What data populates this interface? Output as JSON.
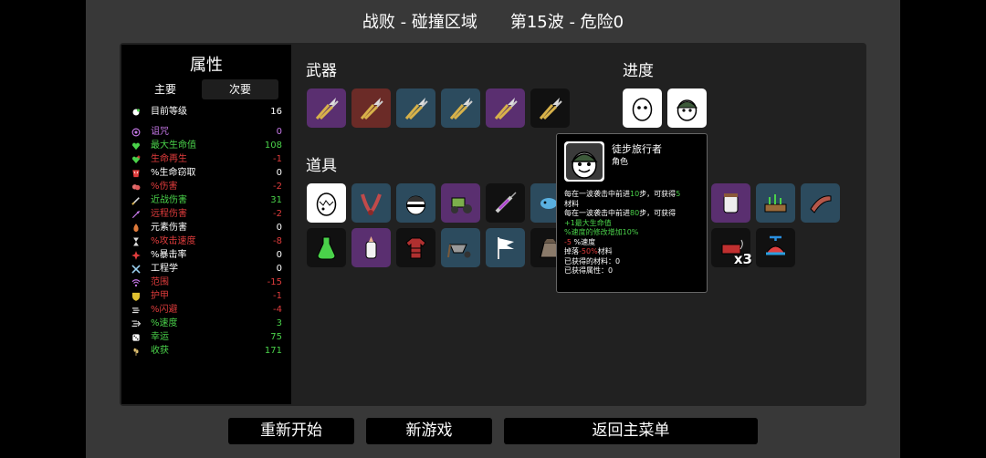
{
  "header": {
    "title": "战败 - 碰撞区域　　第15波 - 危险0"
  },
  "stats": {
    "title": "属性",
    "tab_main": "主要",
    "tab_secondary": "次要",
    "level": {
      "label": "目前等级",
      "value": "16",
      "color": "#ffffff",
      "icon": "level-icon"
    },
    "rows": [
      {
        "label": "诅咒",
        "value": "0",
        "color": "#c678e8",
        "icon": "curse-icon"
      },
      {
        "label": "最大生命值",
        "value": "108",
        "color": "#4ad24a",
        "icon": "heart-icon"
      },
      {
        "label": "生命再生",
        "value": "-1",
        "color": "#e03c3c",
        "icon": "regen-icon"
      },
      {
        "label": "%生命窃取",
        "value": "0",
        "color": "#ffffff",
        "icon": "lifesteal-icon"
      },
      {
        "label": "%伤害",
        "value": "-2",
        "color": "#e03c3c",
        "icon": "damage-icon"
      },
      {
        "label": "近战伤害",
        "value": "31",
        "color": "#4ad24a",
        "icon": "melee-icon"
      },
      {
        "label": "远程伤害",
        "value": "-2",
        "color": "#e03c3c",
        "icon": "ranged-icon"
      },
      {
        "label": "元素伤害",
        "value": "0",
        "color": "#ffffff",
        "icon": "elemental-icon"
      },
      {
        "label": "%攻击速度",
        "value": "-8",
        "color": "#e03c3c",
        "icon": "attack-speed-icon"
      },
      {
        "label": "%暴击率",
        "value": "0",
        "color": "#ffffff",
        "icon": "crit-icon"
      },
      {
        "label": "工程学",
        "value": "0",
        "color": "#ffffff",
        "icon": "engineering-icon"
      },
      {
        "label": "范围",
        "value": "-15",
        "color": "#e03c3c",
        "icon": "range-icon"
      },
      {
        "label": "护甲",
        "value": "-1",
        "color": "#e03c3c",
        "icon": "armor-icon"
      },
      {
        "label": "%闪避",
        "value": "-4",
        "color": "#e03c3c",
        "icon": "dodge-icon"
      },
      {
        "label": "%速度",
        "value": "3",
        "color": "#4ad24a",
        "icon": "speed-icon"
      },
      {
        "label": "幸运",
        "value": "75",
        "color": "#4ad24a",
        "icon": "luck-icon"
      },
      {
        "label": "收获",
        "value": "171",
        "color": "#4ad24a",
        "icon": "harvest-icon"
      }
    ]
  },
  "weapons": {
    "title": "武器",
    "items": [
      {
        "icon": "pruner-icon",
        "bg": "#5a2f70"
      },
      {
        "icon": "pruner-icon",
        "bg": "#6b2b27"
      },
      {
        "icon": "pruner-icon",
        "bg": "#2c4b5e"
      },
      {
        "icon": "pruner-icon",
        "bg": "#2c4b5e"
      },
      {
        "icon": "pruner-icon",
        "bg": "#5a2f70"
      },
      {
        "icon": "pruner-icon",
        "bg": "#111111"
      }
    ]
  },
  "progress": {
    "title": "进度",
    "items": [
      {
        "icon": "potato-egg-icon"
      },
      {
        "icon": "hiker-icon"
      }
    ]
  },
  "items": {
    "title": "道具",
    "row1": [
      {
        "icon": "broken-egg-icon",
        "bg": "#ffffff",
        "count": ""
      },
      {
        "icon": "tentacle-icon",
        "bg": "#2c4b5e",
        "count": ""
      },
      {
        "icon": "helmet-ball-icon",
        "bg": "#2c4b5e",
        "count": ""
      },
      {
        "icon": "tractor-icon",
        "bg": "#5a2f70",
        "count": ""
      },
      {
        "icon": "syringe-icon",
        "bg": "#111111",
        "count": ""
      },
      {
        "icon": "fish-icon",
        "bg": "#2c4b5e",
        "count": ""
      },
      {
        "icon": "jar-icon",
        "bg": "#5a2f70",
        "count": ""
      },
      {
        "icon": "garden-bed-icon",
        "bg": "#2c4b5e",
        "count": ""
      },
      {
        "icon": "scarf-icon",
        "bg": "#2c4b5e",
        "count": ""
      }
    ],
    "row2": [
      {
        "icon": "potion-icon",
        "bg": "#111111",
        "count": ""
      },
      {
        "icon": "baby-bottle-icon",
        "bg": "#5a2f70",
        "count": ""
      },
      {
        "icon": "flannel-shirt-icon",
        "bg": "#111111",
        "count": ""
      },
      {
        "icon": "wheelbarrow-icon",
        "bg": "#2c4b5e",
        "count": ""
      },
      {
        "icon": "flag-icon",
        "bg": "#2c4b5e",
        "count": ""
      },
      {
        "icon": "sack-icon",
        "bg": "#111111",
        "count": "x"
      },
      {
        "icon": "dynamite-icon",
        "bg": "#111111",
        "count": "x3"
      },
      {
        "icon": "propeller-hat-icon",
        "bg": "#111111",
        "count": ""
      }
    ]
  },
  "tooltip": {
    "name": "徒步旅行者",
    "type": "角色",
    "lines": [
      {
        "parts": [
          {
            "t": "每在一波袭击中前进",
            "c": "#ffffff"
          },
          {
            "t": "10",
            "c": "#4ad24a"
          },
          {
            "t": "步，可获得",
            "c": "#ffffff"
          },
          {
            "t": "5",
            "c": "#4ad24a"
          }
        ]
      },
      {
        "parts": [
          {
            "t": "材料",
            "c": "#ffffff"
          }
        ]
      },
      {
        "parts": [
          {
            "t": "每在一波袭击中前进",
            "c": "#ffffff"
          },
          {
            "t": "80",
            "c": "#4ad24a"
          },
          {
            "t": "步，可获得",
            "c": "#ffffff"
          }
        ]
      },
      {
        "parts": [
          {
            "t": "+1最大生命值",
            "c": "#4ad24a"
          }
        ]
      },
      {
        "parts": [
          {
            "t": "%速度的修改增加",
            "c": "#4ad24a"
          },
          {
            "t": "10%",
            "c": "#4ad24a"
          }
        ]
      },
      {
        "parts": [
          {
            "t": "-5",
            "c": "#e03c3c"
          },
          {
            "t": " %速度",
            "c": "#ffffff"
          }
        ]
      },
      {
        "parts": [
          {
            "t": "掉落",
            "c": "#ffffff"
          },
          {
            "t": "-50%",
            "c": "#e03c3c"
          },
          {
            "t": "材料",
            "c": "#ffffff"
          }
        ]
      },
      {
        "parts": [
          {
            "t": "已获得的材料：0",
            "c": "#ffffff"
          }
        ]
      },
      {
        "parts": [
          {
            "t": "已获得属性：0",
            "c": "#ffffff"
          }
        ]
      }
    ]
  },
  "buttons": {
    "restart": "重新开始",
    "new_game": "新游戏",
    "main_menu": "返回主菜单"
  }
}
